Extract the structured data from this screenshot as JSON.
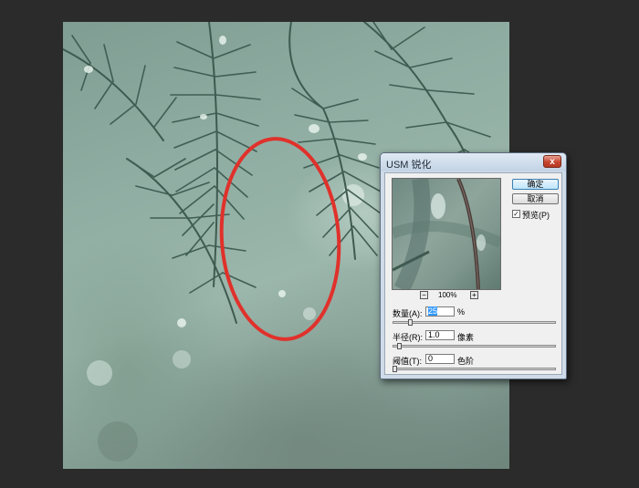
{
  "dialog": {
    "title": "USM 锐化",
    "close_label": "x",
    "ok_label": "确定",
    "cancel_label": "取消",
    "preview_label": "预览(P)",
    "preview_checked": true,
    "preview_check_glyph": "✓",
    "zoom_out_label": "−",
    "zoom_in_label": "+",
    "zoom_level": "100%",
    "amount": {
      "label": "数量(A):",
      "value": "25",
      "unit": "%",
      "slider_fraction": 0.1
    },
    "radius": {
      "label": "半径(R):",
      "value": "1.0",
      "unit": "像素",
      "slider_fraction": 0.03
    },
    "threshold": {
      "label": "阈值(T):",
      "value": "0",
      "unit": "色阶",
      "slider_fraction": 0.0
    }
  },
  "colors": {
    "workspace_bg": "#2b2b2b",
    "annotation_circle": "#e0312b",
    "dialog_frame": "#cfdbe8"
  },
  "icons": {
    "close": "close-icon",
    "zoom_out": "minus-icon",
    "zoom_in": "plus-icon",
    "check": "checkmark-icon"
  }
}
